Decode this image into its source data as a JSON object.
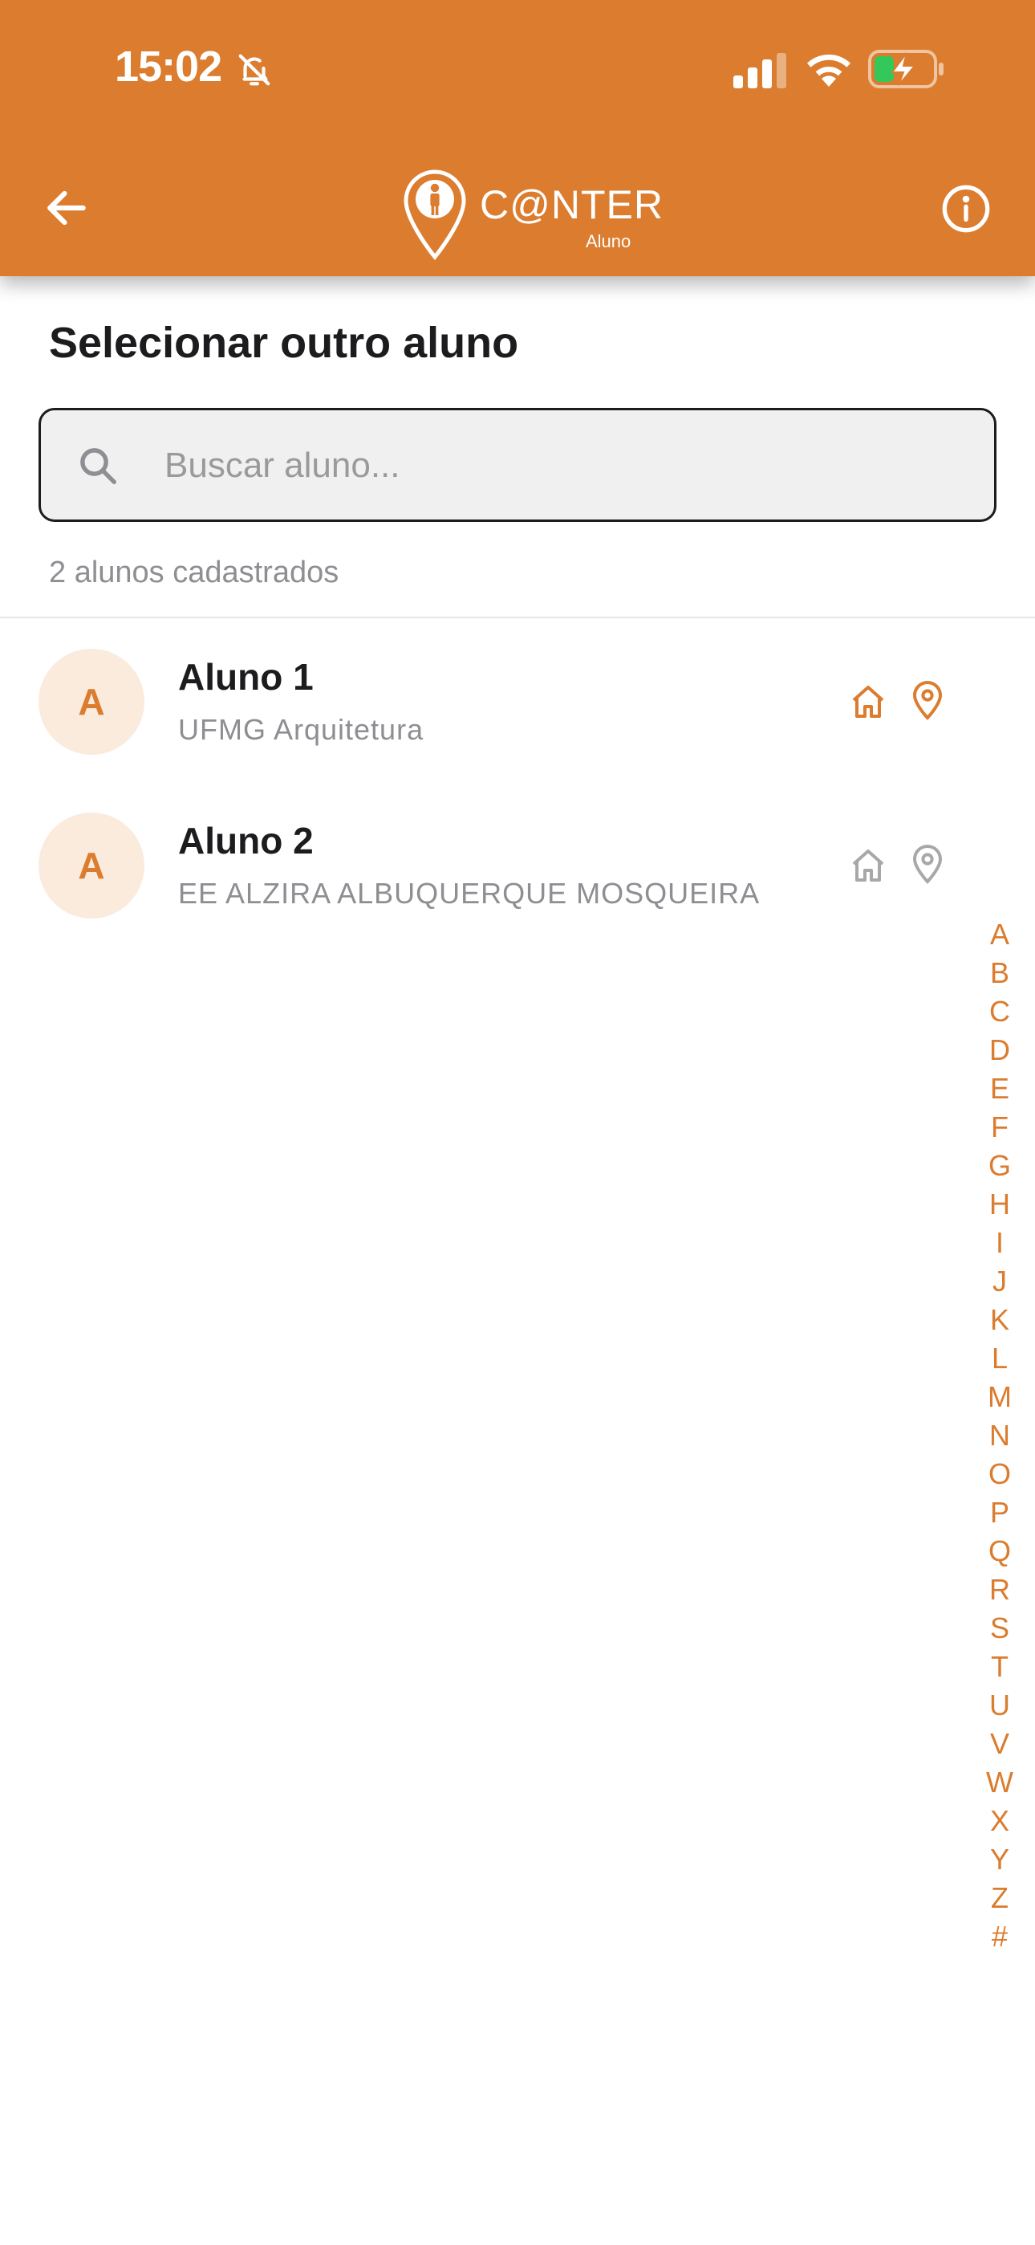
{
  "status_bar": {
    "time": "15:02"
  },
  "header": {
    "logo_text": "C@NTER",
    "logo_subtitle": "Aluno",
    "back_icon": "arrow-left",
    "info_icon": "info-circle"
  },
  "page": {
    "title": "Selecionar outro aluno"
  },
  "search": {
    "placeholder": "Buscar aluno...",
    "value": ""
  },
  "count_text": "2 alunos cadastrados",
  "students": [
    {
      "initial": "A",
      "name": "Aluno 1",
      "school": "UFMG Arquitetura",
      "home_active": true,
      "location_active": true
    },
    {
      "initial": "A",
      "name": "Aluno 2",
      "school": "EE ALZIRA ALBUQUERQUE MOSQUEIRA",
      "home_active": false,
      "location_active": false
    }
  ],
  "alphabet_index": [
    "A",
    "B",
    "C",
    "D",
    "E",
    "F",
    "G",
    "H",
    "I",
    "J",
    "K",
    "L",
    "M",
    "N",
    "O",
    "P",
    "Q",
    "R",
    "S",
    "T",
    "U",
    "V",
    "W",
    "X",
    "Y",
    "Z",
    "#"
  ],
  "colors": {
    "brand": "#DB7C2E",
    "avatar_bg": "#FAEBDD",
    "inactive_icon": "#A8A8A8"
  }
}
